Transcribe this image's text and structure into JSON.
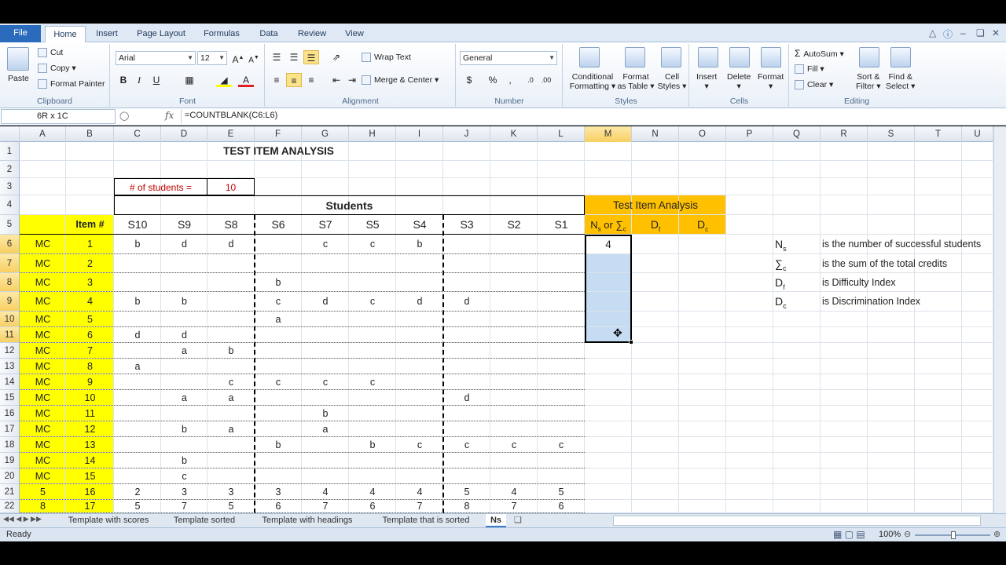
{
  "ribbon_tabs": [
    "File",
    "Home",
    "Insert",
    "Page Layout",
    "Formulas",
    "Data",
    "Review",
    "View"
  ],
  "clipboard": {
    "paste": "Paste",
    "cut": "Cut",
    "copy": "Copy",
    "format_painter": "Format Painter",
    "label": "Clipboard"
  },
  "font": {
    "name": "Arial",
    "size": "12",
    "label": "Font",
    "bold": "B",
    "italic": "I",
    "underline": "U"
  },
  "alignment": {
    "wrap": "Wrap Text",
    "merge": "Merge & Center",
    "label": "Alignment"
  },
  "number": {
    "format": "General",
    "label": "Number"
  },
  "styles": {
    "cond": "Conditional",
    "cond2": "Formatting",
    "fmt_table": "Format",
    "fmt_table2": "as Table",
    "cell_styles": "Cell",
    "cell_styles2": "Styles",
    "label": "Styles"
  },
  "cells": {
    "insert": "Insert",
    "delete": "Delete",
    "format": "Format",
    "label": "Cells"
  },
  "editing": {
    "autosum": "AutoSum",
    "fill": "Fill",
    "clear": "Clear",
    "sort": "Sort &",
    "sort2": "Filter",
    "find": "Find &",
    "find2": "Select",
    "label": "Editing"
  },
  "formula_bar": {
    "name_box": "6R x 1C",
    "fx": "fx",
    "formula": "=COUNTBLANK(C6:L6)"
  },
  "columns": [
    "A",
    "B",
    "C",
    "D",
    "E",
    "F",
    "G",
    "H",
    "I",
    "J",
    "K",
    "L",
    "M",
    "N",
    "O",
    "P",
    "Q",
    "R",
    "S",
    "T",
    "U"
  ],
  "rows": [
    "1",
    "2",
    "3",
    "4",
    "5",
    "6",
    "7",
    "8",
    "9",
    "10",
    "11",
    "12",
    "13",
    "14",
    "15",
    "16",
    "17",
    "18",
    "19",
    "20",
    "21",
    "22"
  ],
  "sheet": {
    "title": "TEST ITEM ANALYSIS",
    "num_students_label": "# of students =",
    "num_students": "10",
    "students_header": "Students",
    "tia_header": "Test Item Analysis",
    "item_header": "Item #",
    "students": [
      "S10",
      "S9",
      "S8",
      "S6",
      "S7",
      "S5",
      "S4",
      "S3",
      "S2",
      "S1"
    ],
    "ns_header": "Ns or ∑c",
    "df_header": "Df",
    "dc_header": "Dc",
    "m6_value": "4",
    "data_rows": [
      [
        "MC",
        "1",
        "b",
        "d",
        "d",
        "",
        "c",
        "c",
        "b",
        "",
        "",
        ""
      ],
      [
        "MC",
        "2",
        "",
        "",
        "",
        "",
        "",
        "",
        "",
        "",
        "",
        ""
      ],
      [
        "MC",
        "3",
        "",
        "",
        "",
        "b",
        "",
        "",
        "",
        "",
        "",
        ""
      ],
      [
        "MC",
        "4",
        "b",
        "b",
        "",
        "c",
        "d",
        "c",
        "d",
        "d",
        "",
        ""
      ],
      [
        "MC",
        "5",
        "",
        "",
        "",
        "a",
        "",
        "",
        "",
        "",
        "",
        ""
      ],
      [
        "MC",
        "6",
        "d",
        "d",
        "",
        "",
        "",
        "",
        "",
        "",
        "",
        ""
      ],
      [
        "MC",
        "7",
        "",
        "a",
        "b",
        "",
        "",
        "",
        "",
        "",
        "",
        ""
      ],
      [
        "MC",
        "8",
        "a",
        "",
        "",
        "",
        "",
        "",
        "",
        "",
        "",
        ""
      ],
      [
        "MC",
        "9",
        "",
        "",
        "c",
        "c",
        "c",
        "c",
        "",
        "",
        "",
        ""
      ],
      [
        "MC",
        "10",
        "",
        "a",
        "a",
        "",
        "",
        "",
        "",
        "d",
        "",
        ""
      ],
      [
        "MC",
        "11",
        "",
        "",
        "",
        "",
        "b",
        "",
        "",
        "",
        "",
        ""
      ],
      [
        "MC",
        "12",
        "",
        "b",
        "a",
        "",
        "a",
        "",
        "",
        "",
        "",
        ""
      ],
      [
        "MC",
        "13",
        "",
        "",
        "",
        "b",
        "",
        "b",
        "c",
        "c",
        "c",
        "c"
      ],
      [
        "MC",
        "14",
        "",
        "b",
        "",
        "",
        "",
        "",
        "",
        "",
        "",
        ""
      ],
      [
        "MC",
        "15",
        "",
        "c",
        "",
        "",
        "",
        "",
        "",
        "",
        "",
        ""
      ],
      [
        "5",
        "16",
        "2",
        "3",
        "3",
        "3",
        "4",
        "4",
        "4",
        "5",
        "4",
        "5"
      ],
      [
        "8",
        "17",
        "5",
        "7",
        "5",
        "6",
        "7",
        "6",
        "7",
        "8",
        "7",
        "6"
      ]
    ],
    "legend": [
      {
        "sym": "Ns",
        "text": "is the number of successful students"
      },
      {
        "sym": "∑c",
        "text": "is the sum of the total credits"
      },
      {
        "sym": "Df",
        "text": "is Difficulty Index"
      },
      {
        "sym": "Dc",
        "text": "is Discrimination Index"
      }
    ]
  },
  "sheet_tabs": [
    "Template with scores",
    "Template sorted",
    "Template with headings",
    "Template that is sorted",
    "Ns"
  ],
  "status": {
    "ready": "Ready",
    "zoom": "100%"
  },
  "colors": {
    "yellow": "#ffff00",
    "orange": "#ffc000",
    "selection": "#c5dcf3",
    "file_tab": "#2a6bbd"
  }
}
